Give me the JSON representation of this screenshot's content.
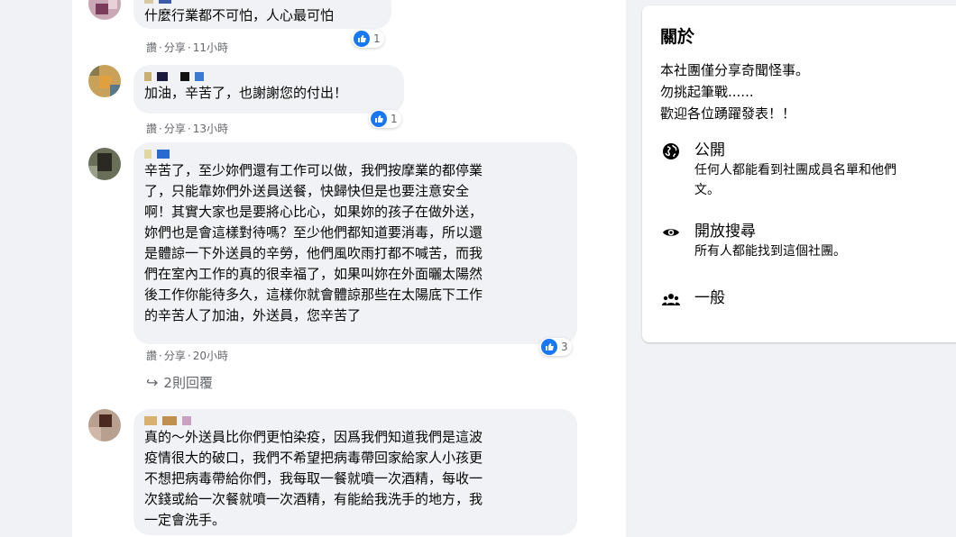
{
  "comments": [
    {
      "text": "什麼行業都不可怕，人心最可怕",
      "like": "讚",
      "share": "分享",
      "time": "11小時",
      "reactions": "1"
    },
    {
      "text": "加油，辛苦了，也謝謝您的付出！",
      "like": "讚",
      "share": "分享",
      "time": "13小時",
      "reactions": "1"
    },
    {
      "text": "辛苦了，至少妳們還有工作可以做，我們按摩業的都停業\n了，只能靠妳們外送員送餐，快歸快但是也要注意安全\n啊！其實大家也是要將心比心，如果妳的孩子在做外送，\n妳們也是會這樣對待嗎？至少他們都知道要消毒，所以還\n是體諒一下外送員的辛勞，他們風吹雨打都不喊苦，而我\n們在室內工作的真的很幸福了，如果叫妳在外面曬太陽然\n後工作你能待多久，這樣你就會體諒那些在太陽底下工作\n的辛苦人了加油，外送員，您辛苦了",
      "like": "讚",
      "share": "分享",
      "time": "20小時",
      "reactions": "3",
      "replies": "2則回覆"
    },
    {
      "text": "真的～外送員比你們更怕染疫，因爲我們知道我們是這波\n疫情很大的破口，我們不希望把病毒帶回家給家人小孩更\n不想把病毒帶給你們，我每取一餐就噴一次酒精，每收一\n次錢或給一次餐就噴一次酒精，有能給我洗手的地方，我\n一定會洗手。"
    }
  ],
  "about": {
    "title": "關於",
    "description": "本社團僅分享奇聞怪事。\n勿挑起筆戰......\n歡迎各位踴躍發表！！",
    "public": {
      "icon": "globe-icon",
      "title": "公開",
      "sub": "任何人都能看到社團成員名單和他們\n文。"
    },
    "searchable": {
      "icon": "eye-icon",
      "title": "開放搜尋",
      "sub": "所有人都能找到這個社團。"
    },
    "general": {
      "icon": "group-icon",
      "title": "一般"
    }
  },
  "colors": {
    "like_blue": "#1877f2",
    "bubble": "#f0f2f5",
    "meta_text": "#65676b"
  }
}
